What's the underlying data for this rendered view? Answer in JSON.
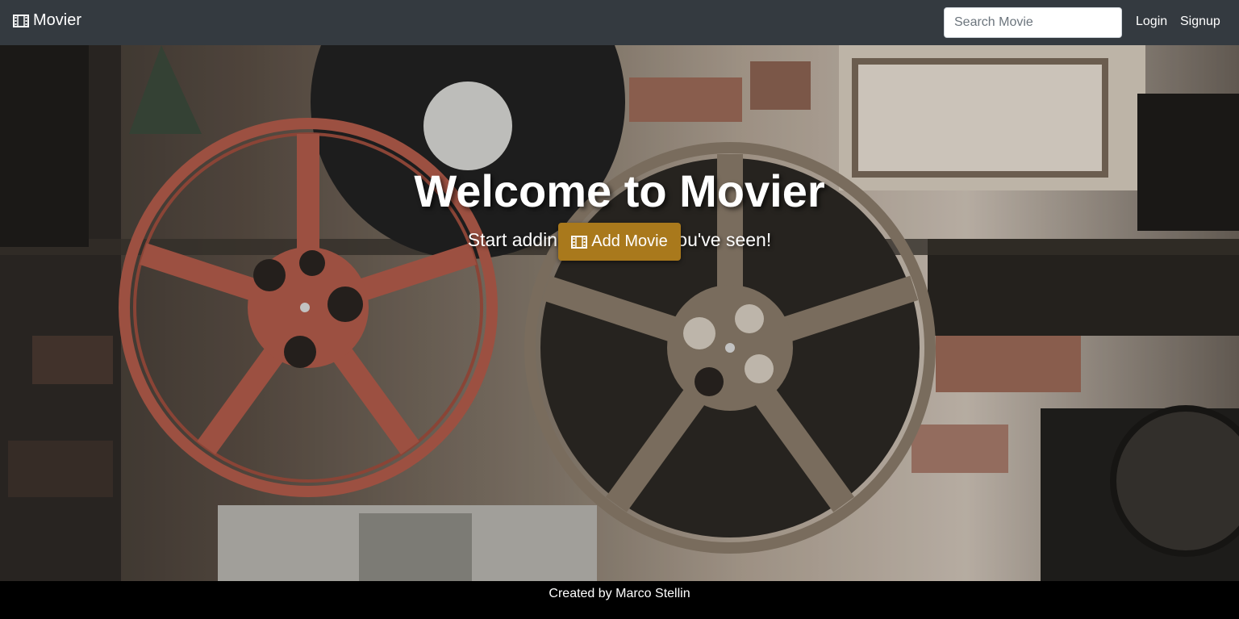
{
  "navbar": {
    "brand_label": "Movier",
    "brand_icon": "film-icon",
    "search": {
      "placeholder": "Search Movie",
      "value": ""
    },
    "login_label": "Login",
    "signup_label": "Signup"
  },
  "hero": {
    "title": "Welcome to Movier",
    "subtitle": "Start adding the movies you've seen!",
    "add_button_label": "Add Movie",
    "add_button_icon": "film-icon"
  },
  "footer": {
    "text": "Created by Marco Stellin"
  },
  "colors": {
    "navbar": "#343a40",
    "accent": "#a9791c",
    "footer": "#000000"
  }
}
